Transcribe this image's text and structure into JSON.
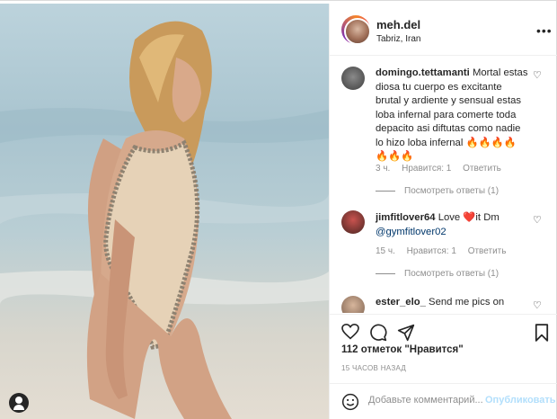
{
  "post": {
    "username": "meh.del",
    "location": "Tabriz, Iran"
  },
  "comments": [
    {
      "username": "domingo.tettamanti",
      "text": "Mortal estas diosa tu cuerpo es excitante brutal y ardiente y sensual estas loba infernal para comerte toda depacito asi diftutas como nadie lo hizo loba infernal 🔥🔥🔥🔥🔥🔥🔥",
      "time": "3 ч.",
      "likes": "Нравится: 1",
      "reply": "Ответить",
      "view_replies": "Посмотреть ответы (1)"
    },
    {
      "username": "jimfitlover64",
      "text": "Love ❤️it Dm",
      "mention": "@gymfitlover02",
      "time": "15 ч.",
      "likes": "Нравится: 1",
      "reply": "Ответить",
      "view_replies": "Посмотреть ответы (1)"
    },
    {
      "username": "ester_elo_",
      "text": "Send me pics on"
    }
  ],
  "likes_text": "112 отметок \"Нравится\"",
  "time_ago": "15 ЧАСОВ НАЗАД",
  "comment_box": {
    "placeholder": "Добавьте комментарий...",
    "publish": "Опубликовать"
  },
  "icons": {
    "heart": "heart-icon",
    "comment": "comment-icon",
    "share": "share-icon",
    "save": "bookmark-icon",
    "emoji": "emoji-icon",
    "more": "more-icon",
    "user": "user-tag-icon"
  },
  "colors": {
    "accent_link": "#00376b",
    "publish_disabled": "#b2dffc",
    "heart_red": "#ed4956"
  }
}
